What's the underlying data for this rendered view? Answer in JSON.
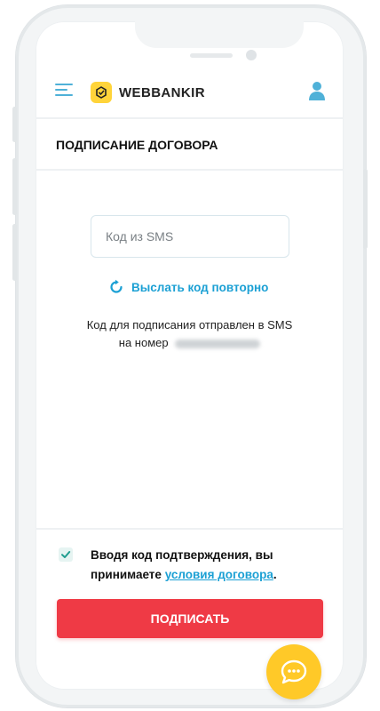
{
  "header": {
    "brand": "WEBBANKIR",
    "menu_icon": "hamburger-menu-icon",
    "user_icon": "user-icon",
    "accent_color": "#4fb1d8",
    "logo_color": "#ffd43a"
  },
  "page": {
    "title": "ПОДПИСАНИЕ ДОГОВОРА"
  },
  "sms_form": {
    "code_placeholder": "Код из SMS",
    "code_value": "",
    "resend_label": "Выслать код повторно",
    "resend_icon": "refresh-icon",
    "info_line1": "Код для подписания отправлен в SMS",
    "info_line2_prefix": "на номер"
  },
  "consent": {
    "checked": true,
    "text_part1": "Вводя код подтверждения, вы принимаете",
    "link_text": "условия договора",
    "text_end": "."
  },
  "actions": {
    "sign_label": "ПОДПИСАТЬ",
    "sign_color": "#ef3a45"
  },
  "chat": {
    "icon": "chat-bubble-icon",
    "color": "#ffc928"
  }
}
